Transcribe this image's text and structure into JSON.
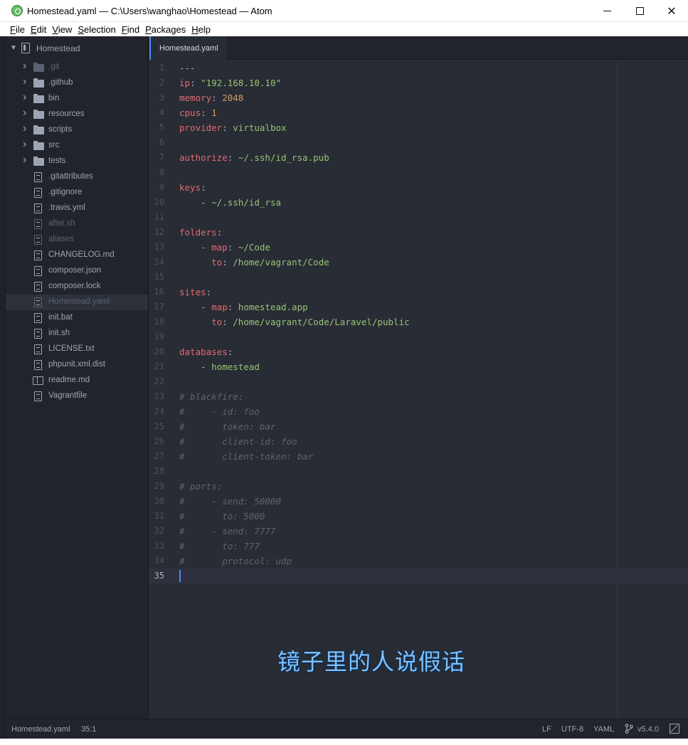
{
  "window": {
    "title": "Homestead.yaml — C:\\Users\\wanghao\\Homestead — Atom",
    "app_icon": "atom-icon",
    "controls": {
      "minimize": "minimize-icon",
      "maximize": "maximize-icon",
      "close": "✕"
    }
  },
  "menu": [
    {
      "acc": "F",
      "rest": "ile"
    },
    {
      "acc": "E",
      "rest": "dit"
    },
    {
      "acc": "V",
      "rest": "iew"
    },
    {
      "acc": "S",
      "rest": "election"
    },
    {
      "acc": "F",
      "rest": "ind"
    },
    {
      "acc": "P",
      "rest": "ackages"
    },
    {
      "acc": "H",
      "rest": "elp"
    }
  ],
  "tree": {
    "root": "Homestead",
    "items": [
      {
        "label": ".git",
        "type": "folder",
        "muted": true
      },
      {
        "label": ".github",
        "type": "folder"
      },
      {
        "label": "bin",
        "type": "folder"
      },
      {
        "label": "resources",
        "type": "folder"
      },
      {
        "label": "scripts",
        "type": "folder"
      },
      {
        "label": "src",
        "type": "folder"
      },
      {
        "label": "tests",
        "type": "folder"
      },
      {
        "label": ".gitattributes",
        "type": "file"
      },
      {
        "label": ".gitignore",
        "type": "file"
      },
      {
        "label": ".travis.yml",
        "type": "file"
      },
      {
        "label": "after.sh",
        "type": "file",
        "muted": true
      },
      {
        "label": "aliases",
        "type": "file",
        "muted": true
      },
      {
        "label": "CHANGELOG.md",
        "type": "file"
      },
      {
        "label": "composer.json",
        "type": "file"
      },
      {
        "label": "composer.lock",
        "type": "file"
      },
      {
        "label": "Homestead.yaml",
        "type": "file",
        "muted": true,
        "selected": true
      },
      {
        "label": "init.bat",
        "type": "file"
      },
      {
        "label": "init.sh",
        "type": "file"
      },
      {
        "label": "LICENSE.txt",
        "type": "file"
      },
      {
        "label": "phpunit.xml.dist",
        "type": "file"
      },
      {
        "label": "readme.md",
        "type": "book"
      },
      {
        "label": "Vagrantfile",
        "type": "file"
      }
    ]
  },
  "tab": {
    "label": "Homestead.yaml"
  },
  "editor": {
    "lines": [
      [
        [
          "p",
          "---"
        ]
      ],
      [
        [
          "k",
          "ip"
        ],
        [
          "p",
          ": "
        ],
        [
          "s",
          "\"192.168.10.10\""
        ]
      ],
      [
        [
          "k",
          "memory"
        ],
        [
          "p",
          ": "
        ],
        [
          "n",
          "2048"
        ]
      ],
      [
        [
          "k",
          "cpus"
        ],
        [
          "p",
          ": "
        ],
        [
          "n",
          "1"
        ]
      ],
      [
        [
          "k",
          "provider"
        ],
        [
          "p",
          ": "
        ],
        [
          "s",
          "virtualbox"
        ]
      ],
      [],
      [
        [
          "k",
          "authorize"
        ],
        [
          "p",
          ": "
        ],
        [
          "s",
          "~/.ssh/id_rsa.pub"
        ]
      ],
      [],
      [
        [
          "k",
          "keys"
        ],
        [
          "p",
          ":"
        ]
      ],
      [
        [
          "p",
          "    - "
        ],
        [
          "s",
          "~/.ssh/id_rsa"
        ]
      ],
      [],
      [
        [
          "k",
          "folders"
        ],
        [
          "p",
          ":"
        ]
      ],
      [
        [
          "p",
          "    - "
        ],
        [
          "k",
          "map"
        ],
        [
          "p",
          ": "
        ],
        [
          "s",
          "~/Code"
        ]
      ],
      [
        [
          "p",
          "      "
        ],
        [
          "k",
          "to"
        ],
        [
          "p",
          ": "
        ],
        [
          "s",
          "/home/vagrant/Code"
        ]
      ],
      [],
      [
        [
          "k",
          "sites"
        ],
        [
          "p",
          ":"
        ]
      ],
      [
        [
          "p",
          "    - "
        ],
        [
          "k",
          "map"
        ],
        [
          "p",
          ": "
        ],
        [
          "s",
          "homestead.app"
        ]
      ],
      [
        [
          "p",
          "      "
        ],
        [
          "k",
          "to"
        ],
        [
          "p",
          ": "
        ],
        [
          "s",
          "/home/vagrant/Code/Laravel/public"
        ]
      ],
      [],
      [
        [
          "k",
          "databases"
        ],
        [
          "p",
          ":"
        ]
      ],
      [
        [
          "p",
          "    - "
        ],
        [
          "s",
          "homestead"
        ]
      ],
      [],
      [
        [
          "c",
          "# blackfire:"
        ]
      ],
      [
        [
          "c",
          "#     - id: foo"
        ]
      ],
      [
        [
          "c",
          "#       token: bar"
        ]
      ],
      [
        [
          "c",
          "#       client-id: foo"
        ]
      ],
      [
        [
          "c",
          "#       client-token: bar"
        ]
      ],
      [],
      [
        [
          "c",
          "# ports:"
        ]
      ],
      [
        [
          "c",
          "#     - send: 50000"
        ]
      ],
      [
        [
          "c",
          "#       to: 5000"
        ]
      ],
      [
        [
          "c",
          "#     - send: 7777"
        ]
      ],
      [
        [
          "c",
          "#       to: 777"
        ]
      ],
      [
        [
          "c",
          "#       protocol: udp"
        ]
      ],
      []
    ],
    "cursor_line": 35
  },
  "subtitle": "镜子里的人说假话",
  "status": {
    "file": "Homestead.yaml",
    "position": "35:1",
    "line_ending": "LF",
    "encoding": "UTF-8",
    "grammar": "YAML",
    "branch_icon": "git-branch-icon",
    "version": "v5.4.0",
    "edit_icon": "edit-icon"
  }
}
